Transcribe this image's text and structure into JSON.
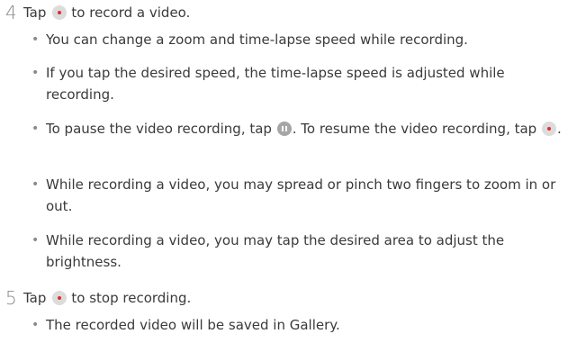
{
  "steps": [
    {
      "number": "4",
      "text_before": "Tap",
      "icon": "record-icon",
      "text_after": "to record a video.",
      "bullets": [
        {
          "text": "You can change a zoom and time-lapse speed while recording."
        },
        {
          "text": "If you tap the desired speed, the time-lapse speed is adjusted while recording."
        },
        {
          "text_a": "To pause the video recording, tap",
          "icon_a": "pause-icon",
          "text_b": ". To resume the video recording, tap",
          "icon_b": "record-icon",
          "text_c": "."
        },
        {
          "text": "While recording a video, you may spread or pinch two fingers to zoom in or out."
        },
        {
          "text": "While recording a video, you may tap the desired area to adjust the brightness."
        }
      ]
    },
    {
      "number": "5",
      "text_before": "Tap",
      "icon": "record-icon",
      "text_after": "to stop recording.",
      "bullets": [
        {
          "text": "The recorded video will be saved in Gallery."
        }
      ]
    }
  ],
  "colors": {
    "text": "#3a3a3a",
    "step_number": "#8a8a8a",
    "record_dot": "#e32b2b",
    "icon_bg": "#dcdcdc",
    "pause_bg": "#a6a6a6"
  }
}
